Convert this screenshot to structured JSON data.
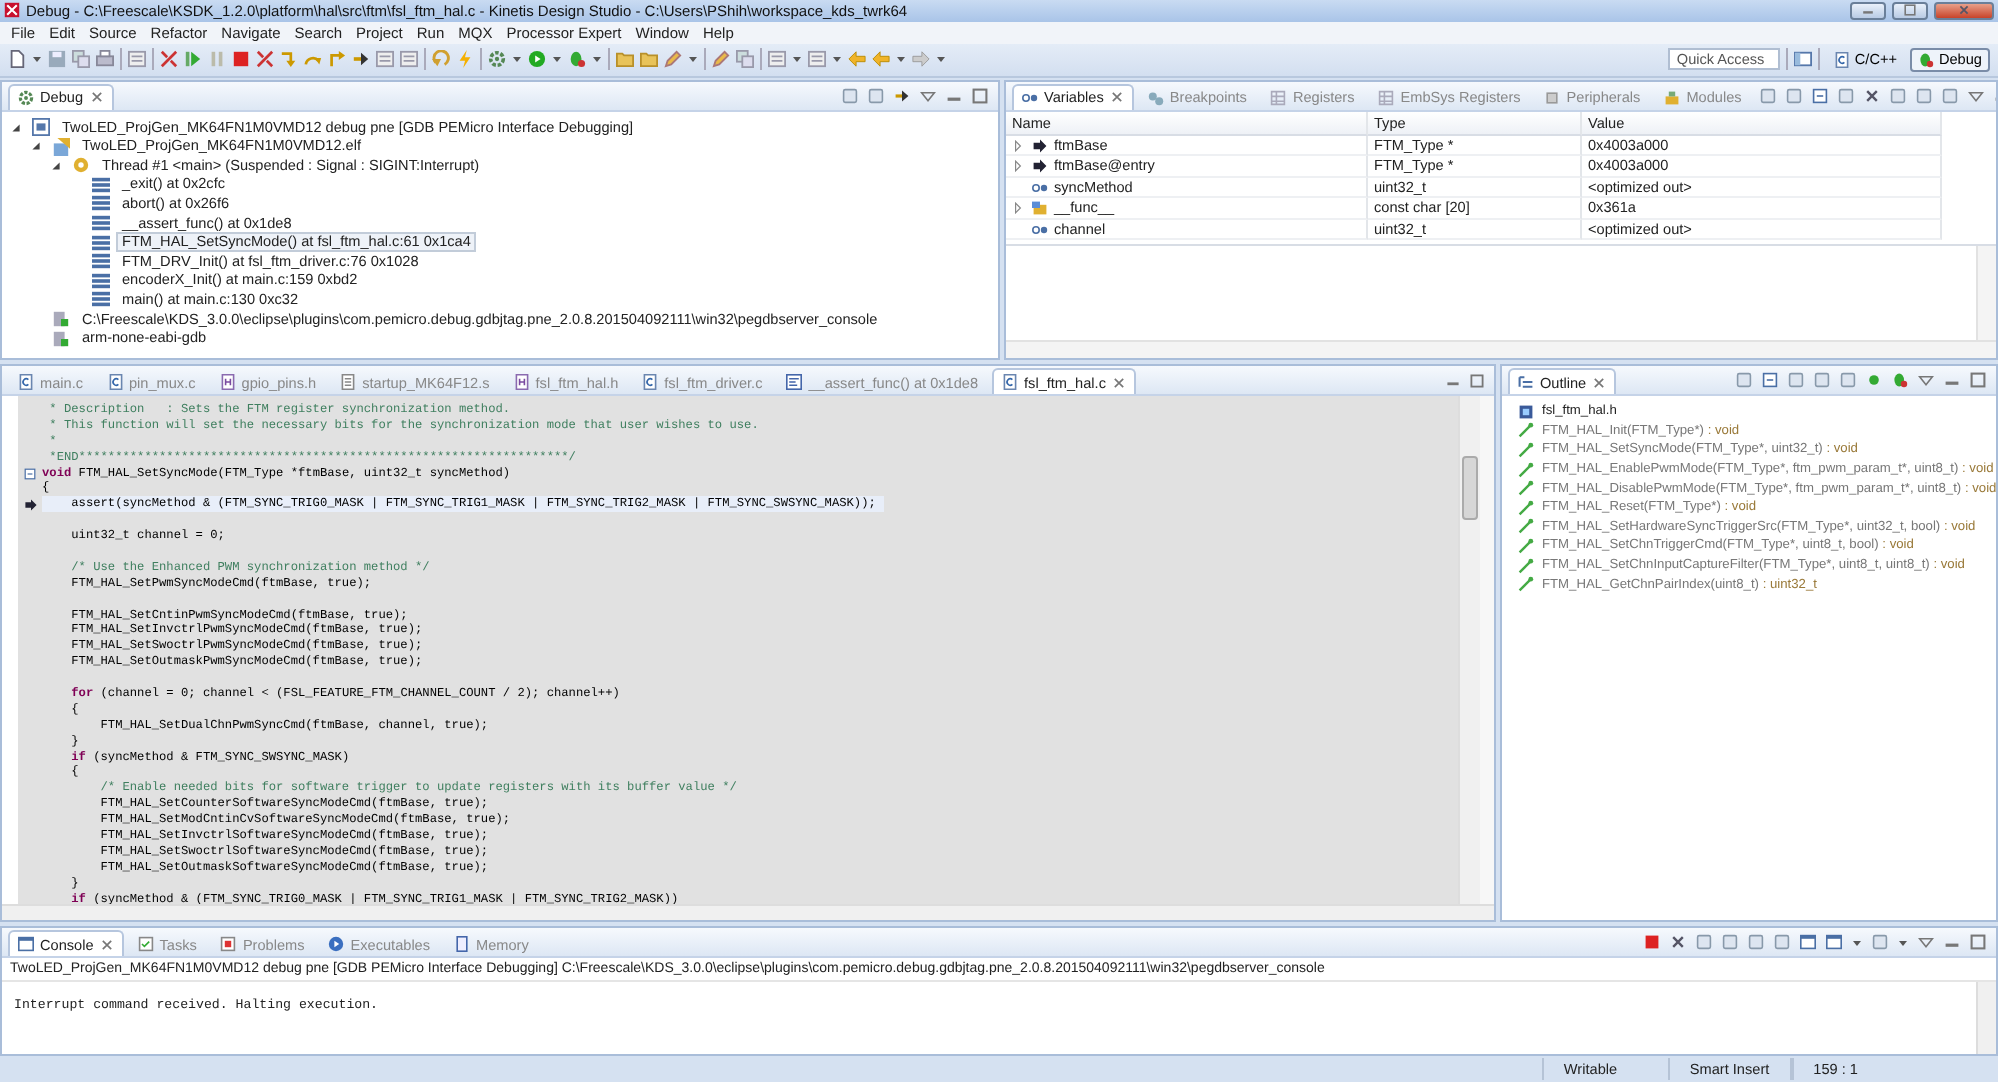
{
  "window": {
    "title": "Debug - C:\\Freescale\\KSDK_1.2.0\\platform\\hal\\src\\ftm\\fsl_ftm_hal.c - Kinetis Design Studio - C:\\Users\\PShih\\workspace_kds_twrk64"
  },
  "menu": [
    "File",
    "Edit",
    "Source",
    "Refactor",
    "Navigate",
    "Search",
    "Project",
    "Run",
    "MQX",
    "Processor Expert",
    "Window",
    "Help"
  ],
  "toolbar": {
    "quick_access": {
      "placeholder": "Quick Access"
    },
    "perspectives": [
      {
        "label": "C/C++",
        "selected": false
      },
      {
        "label": "Debug",
        "selected": true
      }
    ]
  },
  "debug_view": {
    "tabs": [
      {
        "label": "Debug",
        "selected": true
      }
    ],
    "tree": [
      {
        "label": "TwoLED_ProjGen_MK64FN1M0VMD12 debug pne [GDB PEMicro Interface Debugging]",
        "kind": "launch",
        "expanded": true,
        "selected": false,
        "children": [
          {
            "label": "TwoLED_ProjGen_MK64FN1M0VMD12.elf",
            "kind": "program",
            "expanded": true,
            "selected": false,
            "children": [
              {
                "label": "Thread #1 <main> (Suspended : Signal : SIGINT:Interrupt)",
                "kind": "thread",
                "expanded": true,
                "selected": false,
                "children": [
                  {
                    "label": "_exit() at 0x2cfc",
                    "kind": "frame",
                    "selected": false
                  },
                  {
                    "label": "abort() at 0x26f6",
                    "kind": "frame",
                    "selected": false
                  },
                  {
                    "label": "__assert_func() at 0x1de8",
                    "kind": "frame",
                    "selected": false
                  },
                  {
                    "label": "FTM_HAL_SetSyncMode() at fsl_ftm_hal.c:61 0x1ca4",
                    "kind": "frame",
                    "selected": true
                  },
                  {
                    "label": "FTM_DRV_Init() at fsl_ftm_driver.c:76 0x1028",
                    "kind": "frame",
                    "selected": false
                  },
                  {
                    "label": "encoderX_Init() at main.c:159 0xbd2",
                    "kind": "frame",
                    "selected": false
                  },
                  {
                    "label": "main() at main.c:130 0xc32",
                    "kind": "frame",
                    "selected": false
                  }
                ]
              }
            ]
          },
          {
            "label": "C:\\Freescale\\KDS_3.0.0\\eclipse\\plugins\\com.pemicro.debug.gdbjtag.pne_2.0.8.201504092111\\win32\\pegdbserver_console",
            "kind": "process",
            "selected": false
          },
          {
            "label": "arm-none-eabi-gdb",
            "kind": "process",
            "selected": false
          }
        ]
      }
    ]
  },
  "variables_view": {
    "tabs": [
      {
        "label": "Variables",
        "selected": true
      },
      {
        "label": "Breakpoints",
        "selected": false
      },
      {
        "label": "Registers",
        "selected": false
      },
      {
        "label": "EmbSys Registers",
        "selected": false
      },
      {
        "label": "Peripherals",
        "selected": false
      },
      {
        "label": "Modules",
        "selected": false
      }
    ],
    "columns": [
      "Name",
      "Type",
      "Value"
    ],
    "rows": [
      {
        "name": "ftmBase",
        "type": "FTM_Type *",
        "value": "0x4003a000",
        "kind": "pointer",
        "expandable": true
      },
      {
        "name": "ftmBase@entry",
        "type": "FTM_Type *",
        "value": "0x4003a000",
        "kind": "pointer",
        "expandable": true
      },
      {
        "name": "syncMethod",
        "type": "uint32_t",
        "value": "<optimized out>",
        "kind": "variable",
        "expandable": false
      },
      {
        "name": "__func__",
        "type": "const char [20]",
        "value": "0x361a",
        "kind": "array",
        "expandable": true
      },
      {
        "name": "channel",
        "type": "uint32_t",
        "value": "<optimized out>",
        "kind": "variable",
        "expandable": false
      }
    ]
  },
  "editor": {
    "tabs": [
      {
        "label": "main.c",
        "kind": "c",
        "selected": false
      },
      {
        "label": "pin_mux.c",
        "kind": "c",
        "selected": false
      },
      {
        "label": "gpio_pins.h",
        "kind": "h",
        "selected": false
      },
      {
        "label": "startup_MK64F12.s",
        "kind": "s",
        "selected": false
      },
      {
        "label": "fsl_ftm_hal.h",
        "kind": "h",
        "selected": false
      },
      {
        "label": "fsl_ftm_driver.c",
        "kind": "c",
        "selected": false
      },
      {
        "label": "__assert_func() at 0x1de8",
        "kind": "disassembly",
        "selected": false
      },
      {
        "label": "fsl_ftm_hal.c",
        "kind": "c",
        "selected": true
      }
    ],
    "lines": [
      {
        "kind": "text",
        "fold": false,
        "current": false,
        "segments": [
          {
            "kind": "comment",
            "text": " * Description   : Sets the FTM register synchronization method."
          }
        ]
      },
      {
        "kind": "text",
        "fold": false,
        "current": false,
        "segments": [
          {
            "kind": "comment",
            "text": " * This function will set the necessary bits for the synchronization mode that user wishes to use."
          }
        ]
      },
      {
        "kind": "text",
        "fold": false,
        "current": false,
        "segments": [
          {
            "kind": "comment",
            "text": " *"
          }
        ]
      },
      {
        "kind": "text",
        "fold": false,
        "current": false,
        "segments": [
          {
            "kind": "comment",
            "text": " *END*******************************************************************/"
          }
        ]
      },
      {
        "kind": "text",
        "fold": true,
        "current": false,
        "segments": [
          {
            "kind": "keyword",
            "text": "void"
          },
          {
            "kind": "plain",
            "text": " FTM_HAL_SetSyncMode(FTM_Type *ftmBase, uint32_t syncMethod)"
          }
        ]
      },
      {
        "kind": "text",
        "fold": false,
        "current": false,
        "segments": [
          {
            "kind": "plain",
            "text": "{"
          }
        ]
      },
      {
        "kind": "text",
        "fold": false,
        "current": true,
        "segments": [
          {
            "kind": "plain",
            "text": "    assert(syncMethod & (FTM_SYNC_TRIG0_MASK | FTM_SYNC_TRIG1_MASK | FTM_SYNC_TRIG2_MASK | FTM_SYNC_SWSYNC_MASK));"
          }
        ]
      },
      {
        "kind": "blank",
        "fold": false,
        "current": false
      },
      {
        "kind": "text",
        "fold": false,
        "current": false,
        "segments": [
          {
            "kind": "plain",
            "text": "    uint32_t channel = 0;"
          }
        ]
      },
      {
        "kind": "blank",
        "fold": false,
        "current": false
      },
      {
        "kind": "text",
        "fold": false,
        "current": false,
        "segments": [
          {
            "kind": "comment",
            "text": "    /* Use the Enhanced PWM synchronization method */"
          }
        ]
      },
      {
        "kind": "text",
        "fold": false,
        "current": false,
        "segments": [
          {
            "kind": "plain",
            "text": "    FTM_HAL_SetPwmSyncModeCmd(ftmBase, true);"
          }
        ]
      },
      {
        "kind": "blank",
        "fold": false,
        "current": false
      },
      {
        "kind": "text",
        "fold": false,
        "current": false,
        "segments": [
          {
            "kind": "plain",
            "text": "    FTM_HAL_SetCntinPwmSyncModeCmd(ftmBase, true);"
          }
        ]
      },
      {
        "kind": "text",
        "fold": false,
        "current": false,
        "segments": [
          {
            "kind": "plain",
            "text": "    FTM_HAL_SetInvctrlPwmSyncModeCmd(ftmBase, true);"
          }
        ]
      },
      {
        "kind": "text",
        "fold": false,
        "current": false,
        "segments": [
          {
            "kind": "plain",
            "text": "    FTM_HAL_SetSwoctrlPwmSyncModeCmd(ftmBase, true);"
          }
        ]
      },
      {
        "kind": "text",
        "fold": false,
        "current": false,
        "segments": [
          {
            "kind": "plain",
            "text": "    FTM_HAL_SetOutmaskPwmSyncModeCmd(ftmBase, true);"
          }
        ]
      },
      {
        "kind": "blank",
        "fold": false,
        "current": false
      },
      {
        "kind": "text",
        "fold": false,
        "current": false,
        "segments": [
          {
            "kind": "keyword",
            "text": "    for"
          },
          {
            "kind": "plain",
            "text": " (channel = 0; channel < (FSL_FEATURE_FTM_CHANNEL_COUNT / 2); channel++)"
          }
        ]
      },
      {
        "kind": "text",
        "fold": false,
        "current": false,
        "segments": [
          {
            "kind": "plain",
            "text": "    {"
          }
        ]
      },
      {
        "kind": "text",
        "fold": false,
        "current": false,
        "segments": [
          {
            "kind": "plain",
            "text": "        FTM_HAL_SetDualChnPwmSyncCmd(ftmBase, channel, true);"
          }
        ]
      },
      {
        "kind": "text",
        "fold": false,
        "current": false,
        "segments": [
          {
            "kind": "plain",
            "text": "    }"
          }
        ]
      },
      {
        "kind": "text",
        "fold": false,
        "current": false,
        "segments": [
          {
            "kind": "keyword",
            "text": "    if"
          },
          {
            "kind": "plain",
            "text": " (syncMethod & FTM_SYNC_SWSYNC_MASK)"
          }
        ]
      },
      {
        "kind": "text",
        "fold": false,
        "current": false,
        "segments": [
          {
            "kind": "plain",
            "text": "    {"
          }
        ]
      },
      {
        "kind": "text",
        "fold": false,
        "current": false,
        "segments": [
          {
            "kind": "comment",
            "text": "        /* Enable needed bits for software trigger to update registers with its buffer value */"
          }
        ]
      },
      {
        "kind": "text",
        "fold": false,
        "current": false,
        "segments": [
          {
            "kind": "plain",
            "text": "        FTM_HAL_SetCounterSoftwareSyncModeCmd(ftmBase, true);"
          }
        ]
      },
      {
        "kind": "text",
        "fold": false,
        "current": false,
        "segments": [
          {
            "kind": "plain",
            "text": "        FTM_HAL_SetModCntinCvSoftwareSyncModeCmd(ftmBase, true);"
          }
        ]
      },
      {
        "kind": "text",
        "fold": false,
        "current": false,
        "segments": [
          {
            "kind": "plain",
            "text": "        FTM_HAL_SetInvctrlSoftwareSyncModeCmd(ftmBase, true);"
          }
        ]
      },
      {
        "kind": "text",
        "fold": false,
        "current": false,
        "segments": [
          {
            "kind": "plain",
            "text": "        FTM_HAL_SetSwoctrlSoftwareSyncModeCmd(ftmBase, true);"
          }
        ]
      },
      {
        "kind": "text",
        "fold": false,
        "current": false,
        "segments": [
          {
            "kind": "plain",
            "text": "        FTM_HAL_SetOutmaskSoftwareSyncModeCmd(ftmBase, true);"
          }
        ]
      },
      {
        "kind": "text",
        "fold": false,
        "current": false,
        "segments": [
          {
            "kind": "plain",
            "text": "    }"
          }
        ]
      },
      {
        "kind": "text",
        "fold": false,
        "current": false,
        "segments": [
          {
            "kind": "keyword",
            "text": "    if"
          },
          {
            "kind": "plain",
            "text": " (syncMethod & (FTM_SYNC_TRIG0_MASK | FTM_SYNC_TRIG1_MASK | FTM_SYNC_TRIG2_MASK))"
          }
        ]
      }
    ]
  },
  "outline": {
    "tabs": [
      {
        "label": "Outline",
        "selected": true
      }
    ],
    "items": [
      {
        "label": "fsl_ftm_hal.h",
        "kind": "include"
      },
      {
        "label": "FTM_HAL_Init(FTM_Type*)",
        "returns": ": void",
        "kind": "function"
      },
      {
        "label": "FTM_HAL_SetSyncMode(FTM_Type*, uint32_t)",
        "returns": ": void",
        "kind": "function"
      },
      {
        "label": "FTM_HAL_EnablePwmMode(FTM_Type*, ftm_pwm_param_t*, uint8_t)",
        "returns": ": void",
        "kind": "function"
      },
      {
        "label": "FTM_HAL_DisablePwmMode(FTM_Type*, ftm_pwm_param_t*, uint8_t)",
        "returns": ": void",
        "kind": "function"
      },
      {
        "label": "FTM_HAL_Reset(FTM_Type*)",
        "returns": ": void",
        "kind": "function"
      },
      {
        "label": "FTM_HAL_SetHardwareSyncTriggerSrc(FTM_Type*, uint32_t, bool)",
        "returns": ": void",
        "kind": "function"
      },
      {
        "label": "FTM_HAL_SetChnTriggerCmd(FTM_Type*, uint8_t, bool)",
        "returns": ": void",
        "kind": "function"
      },
      {
        "label": "FTM_HAL_SetChnInputCaptureFilter(FTM_Type*, uint8_t, uint8_t)",
        "returns": ": void",
        "kind": "function"
      },
      {
        "label": "FTM_HAL_GetChnPairIndex(uint8_t)",
        "returns": ": uint32_t",
        "kind": "function"
      }
    ]
  },
  "console": {
    "tabs": [
      {
        "label": "Console",
        "selected": true
      },
      {
        "label": "Tasks",
        "selected": false
      },
      {
        "label": "Problems",
        "selected": false
      },
      {
        "label": "Executables",
        "selected": false
      },
      {
        "label": "Memory",
        "selected": false
      }
    ],
    "process": "TwoLED_ProjGen_MK64FN1M0VMD12 debug pne [GDB PEMicro Interface Debugging] C:\\Freescale\\KDS_3.0.0\\eclipse\\plugins\\com.pemicro.debug.gdbjtag.pne_2.0.8.201504092111\\win32\\pegdbserver_console",
    "output": [
      "Interrupt command received. Halting execution."
    ]
  },
  "status_bar": [
    "Writable",
    "Smart Insert",
    "159 : 1"
  ]
}
